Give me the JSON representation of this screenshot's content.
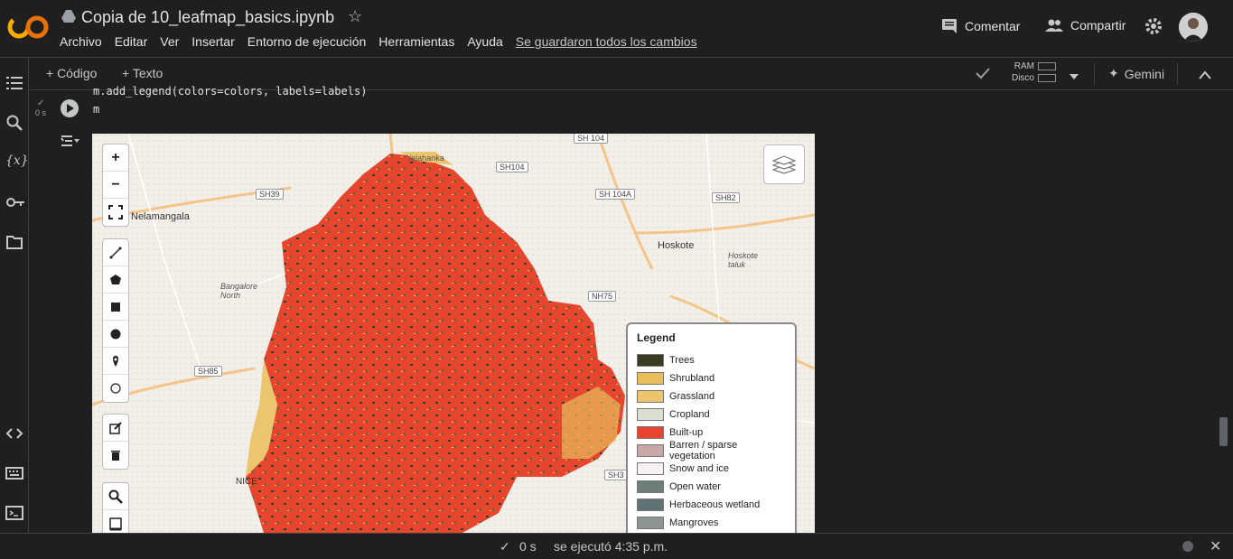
{
  "header": {
    "notebook_title": "Copia de 10_leafmap_basics.ipynb",
    "menu": [
      "Archivo",
      "Editar",
      "Ver",
      "Insertar",
      "Entorno de ejecución",
      "Herramientas",
      "Ayuda"
    ],
    "save_status": "Se guardaron todos los cambios",
    "comment_label": "Comentar",
    "share_label": "Compartir"
  },
  "toolbar": {
    "code_label": "+ Código",
    "text_label": "+ Texto",
    "ram_label": "RAM",
    "disk_label": "Disco",
    "gemini_label": "Gemini"
  },
  "cell": {
    "code_line_1": "m.add_legend(colors=colors, labels=labels)",
    "code_line_2": "m",
    "exec_time": "0 s"
  },
  "map": {
    "labels": {
      "nelamangala": "Nelamangala",
      "hoskote": "Hoskote",
      "hoskote_taluk": "Hoskote taluk",
      "bangalore_north": "Bangalore North",
      "yelahanka": "Yelahanka",
      "nice": "NICE"
    },
    "roads": {
      "sh104_top": "SH 104",
      "sh104": "SH104",
      "sh104a": "SH 104A",
      "sh82": "SH82",
      "sh39": "SH39",
      "nh75": "NH75",
      "sh85": "SH85",
      "sh3": "SH3"
    },
    "legend": {
      "title": "Legend",
      "items": [
        {
          "label": "Trees",
          "color": "#3b3a22"
        },
        {
          "label": "Shrubland",
          "color": "#e8be5a"
        },
        {
          "label": "Grassland",
          "color": "#ecc66f"
        },
        {
          "label": "Cropland",
          "color": "#dcdcd0"
        },
        {
          "label": "Built-up",
          "color": "#e8452f"
        },
        {
          "label": "Barren / sparse vegetation",
          "color": "#c8a8a4"
        },
        {
          "label": "Snow and ice",
          "color": "#f7f2ef"
        },
        {
          "label": "Open water",
          "color": "#6d7d79"
        },
        {
          "label": "Herbaceous wetland",
          "color": "#5f7275"
        },
        {
          "label": "Mangroves",
          "color": "#8d9592"
        }
      ]
    }
  },
  "status": {
    "time": "0 s",
    "message": "se ejecutó 4:35 p.m."
  },
  "colors": {
    "background": "#1f1f1f",
    "builtup": "#e8452f",
    "logo_orange": "#f9ab00",
    "logo_red": "#e8710a"
  }
}
